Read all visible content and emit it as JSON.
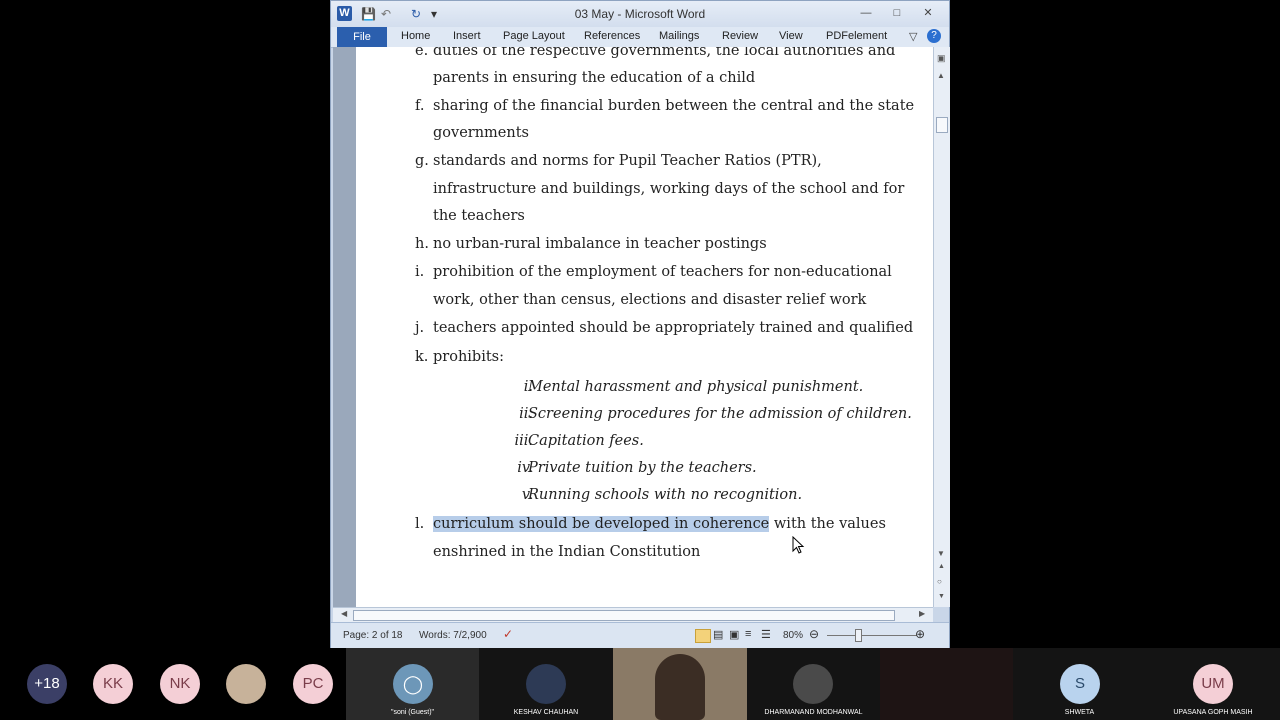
{
  "window": {
    "title": "03 May  -  Microsoft Word",
    "app_icon": "W",
    "qat_icons": [
      "save-icon",
      "undo-icon",
      "redo-icon",
      "customize-qat-icon"
    ],
    "controls": [
      "minimize-icon",
      "maximize-icon",
      "close-icon"
    ]
  },
  "ribbon": {
    "file": "File",
    "tabs": [
      "Home",
      "Insert",
      "Page Layout",
      "References",
      "Mailings",
      "Review",
      "View",
      "PDFelement"
    ]
  },
  "document": {
    "lines": [
      {
        "letter": "e.",
        "text": "duties of the respective governments, the local authorities and"
      },
      {
        "letter": "",
        "text": "parents in ensuring the education of a child"
      },
      {
        "letter": "f.",
        "text": "sharing of the financial burden between the central and the state"
      },
      {
        "letter": "",
        "text": "governments"
      },
      {
        "letter": "g.",
        "text": "standards  and  norms  for  Pupil  Teacher  Ratios  (PTR),"
      },
      {
        "letter": "",
        "text": "infrastructure  and  buildings, working days of the school and for"
      },
      {
        "letter": "",
        "text": "the teachers"
      },
      {
        "letter": "h.",
        "text": "no urban-rural imbalance in teacher postings"
      },
      {
        "letter": "i.",
        "text": "prohibition of the employment of teachers for non-educational"
      },
      {
        "letter": "",
        "text": "work, other than census, elections and disaster relief work"
      },
      {
        "letter": "j.",
        "text": "teachers appointed should be appropriately trained and qualified"
      },
      {
        "letter": "k.",
        "text": "prohibits:"
      }
    ],
    "sub_items": [
      {
        "num": "i.",
        "text": "Mental harassment and physical punishment."
      },
      {
        "num": "ii.",
        "text": "Screening procedures for the admission of children."
      },
      {
        "num": "iii.",
        "text": "Capitation fees."
      },
      {
        "num": "iv.",
        "text": "Private tuition by the teachers."
      },
      {
        "num": "v.",
        "text": "Running schools with no recognition."
      }
    ],
    "last": {
      "letter": "l.",
      "selected": "curriculum should be developed in coherence",
      "rest": " with the values",
      "line2": "enshrined in the Indian Constitution"
    }
  },
  "status": {
    "page": "Page: 2 of 18",
    "words": "Words: 7/2,900",
    "zoom": "80%"
  },
  "participants": [
    {
      "label": "+18",
      "name": "",
      "color": "#3b3f66",
      "fg": "#ffffff"
    },
    {
      "label": "KK",
      "name": "",
      "color": "#f4cfd6",
      "fg": "#7a3d4a"
    },
    {
      "label": "NK",
      "name": "",
      "color": "#f4cfd6",
      "fg": "#7a3d4a"
    },
    {
      "label": "",
      "name": "",
      "color": "#c7b29a",
      "fg": "#ffffff"
    },
    {
      "label": "PC",
      "name": "",
      "color": "#f4cfd6",
      "fg": "#7a3d4a"
    },
    {
      "label": "",
      "name": "\"soni (Guest)\"",
      "color": "#6d97b8",
      "fg": "#ffffff"
    },
    {
      "label": "",
      "name": "KESHAV CHAUHAN",
      "color": "#2d3a55",
      "fg": "#ffffff"
    },
    {
      "label": "",
      "name": "",
      "color": "#5a4a3d",
      "fg": "#ffffff"
    },
    {
      "label": "",
      "name": "DHARMANAND MODHANWAL",
      "color": "#4a4a4a",
      "fg": "#ffffff"
    },
    {
      "label": "",
      "name": "",
      "color": "#3a2a2a",
      "fg": "#ffffff"
    },
    {
      "label": "S",
      "name": "SHWETA",
      "color": "#b9d3ee",
      "fg": "#2a4a6a"
    },
    {
      "label": "UM",
      "name": "UPASANA GOPH MASIH",
      "color": "#f4cfd6",
      "fg": "#7a3d4a"
    }
  ]
}
